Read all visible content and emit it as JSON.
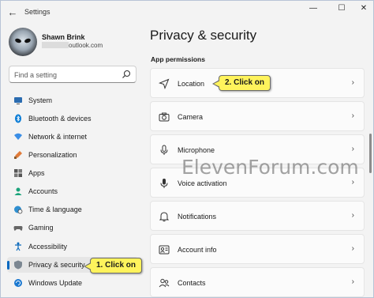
{
  "window": {
    "title": "Settings",
    "back_glyph": "←",
    "minimize_glyph": "—",
    "maximize_glyph": "☐",
    "close_glyph": "✕"
  },
  "profile": {
    "name": "Shawn Brink",
    "email_visible": "outlook.com"
  },
  "search": {
    "placeholder": "Find a setting"
  },
  "sidebar": {
    "items": [
      {
        "label": "System",
        "icon": "monitor-icon"
      },
      {
        "label": "Bluetooth & devices",
        "icon": "bluetooth-icon"
      },
      {
        "label": "Network & internet",
        "icon": "wifi-icon"
      },
      {
        "label": "Personalization",
        "icon": "brush-icon"
      },
      {
        "label": "Apps",
        "icon": "apps-icon"
      },
      {
        "label": "Accounts",
        "icon": "accounts-icon"
      },
      {
        "label": "Time & language",
        "icon": "globe-clock-icon"
      },
      {
        "label": "Gaming",
        "icon": "gamepad-icon"
      },
      {
        "label": "Accessibility",
        "icon": "accessibility-icon"
      },
      {
        "label": "Privacy & security",
        "icon": "shield-icon",
        "active": true
      },
      {
        "label": "Windows Update",
        "icon": "update-icon"
      }
    ]
  },
  "main": {
    "title": "Privacy & security",
    "section": "App permissions",
    "rows": [
      {
        "label": "Location",
        "icon": "location-arrow-icon"
      },
      {
        "label": "Camera",
        "icon": "camera-icon"
      },
      {
        "label": "Microphone",
        "icon": "microphone-icon"
      },
      {
        "label": "Voice activation",
        "icon": "voice-activation-icon"
      },
      {
        "label": "Notifications",
        "icon": "bell-icon"
      },
      {
        "label": "Account info",
        "icon": "account-info-icon"
      },
      {
        "label": "Contacts",
        "icon": "contacts-icon"
      }
    ],
    "chevron": "›"
  },
  "callouts": {
    "step1": "1. Click on",
    "step2": "2. Click on"
  },
  "watermark": "ElevenForum.com",
  "colors": {
    "accent": "#0067c0",
    "callout": "#fff35c",
    "background": "#f3f3f3"
  }
}
